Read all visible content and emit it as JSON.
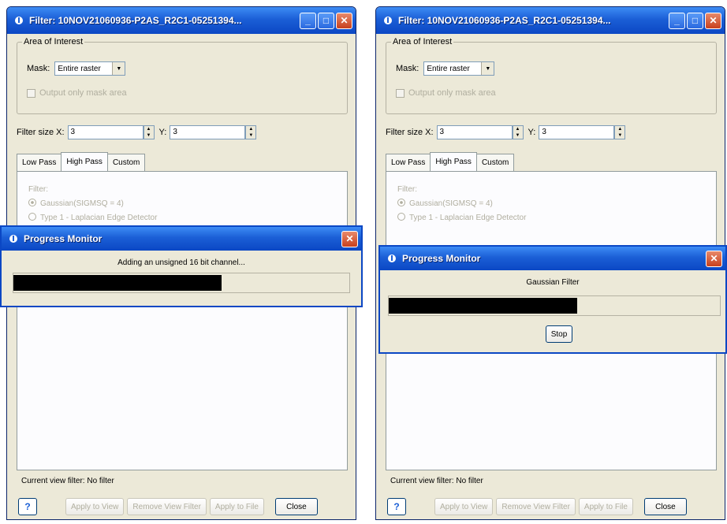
{
  "left": {
    "window": {
      "title": "Filter: 10NOV21060936-P2AS_R2C1-05251394..."
    },
    "area_of_interest": {
      "legend": "Area of Interest",
      "mask_label": "Mask:",
      "mask_value": "Entire raster",
      "output_label": "Output only mask area"
    },
    "filter_size": {
      "x_label": "Filter size X:",
      "x_value": "3",
      "y_label": "Y:",
      "y_value": "3"
    },
    "tabs": [
      "Low Pass",
      "High Pass",
      "Custom"
    ],
    "tab_content": {
      "filter_label": "Filter:",
      "option1": "Gaussian(SIGMSQ = 4)",
      "option2": "Type 1 - Laplacian Edge Detector"
    },
    "current_view": "Current view filter:  No filter",
    "buttons": {
      "apply_view": "Apply to View",
      "remove_view": "Remove View Filter",
      "apply_file": "Apply to File",
      "close": "Close"
    },
    "progress": {
      "title": "Progress Monitor",
      "message": "Adding an unsigned 16 bit channel...",
      "fraction": 0.62
    }
  },
  "right": {
    "window": {
      "title": "Filter: 10NOV21060936-P2AS_R2C1-05251394..."
    },
    "area_of_interest": {
      "legend": "Area of Interest",
      "mask_label": "Mask:",
      "mask_value": "Entire raster",
      "output_label": "Output only mask area"
    },
    "filter_size": {
      "x_label": "Filter size X:",
      "x_value": "3",
      "y_label": "Y:",
      "y_value": "3"
    },
    "tabs": [
      "Low Pass",
      "High Pass",
      "Custom"
    ],
    "tab_content": {
      "filter_label": "Filter:",
      "option1": "Gaussian(SIGMSQ = 4)",
      "option2": "Type 1 - Laplacian Edge Detector"
    },
    "current_view": "Current view filter:  No filter",
    "buttons": {
      "apply_view": "Apply to View",
      "remove_view": "Remove View Filter",
      "apply_file": "Apply to File",
      "close": "Close"
    },
    "progress": {
      "title": "Progress Monitor",
      "message": "Gaussian Filter",
      "fraction": 0.57,
      "stop": "Stop"
    }
  },
  "colors": {
    "titlebar": "#0b47c4",
    "window_bg": "#ece9d8",
    "progress_fill": "#000000"
  }
}
